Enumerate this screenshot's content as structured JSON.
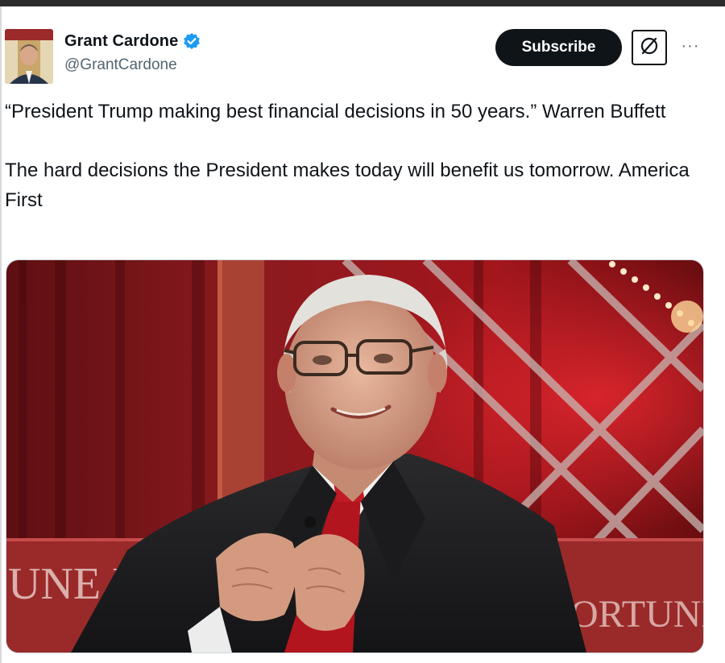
{
  "author": {
    "display_name": "Grant Cardone",
    "handle": "@GrantCardone",
    "verified": true
  },
  "actions": {
    "subscribe_label": "Subscribe",
    "grok_icon": "grok-slash-icon",
    "more_icon": "more-horizontal-icon",
    "more_glyph": "···"
  },
  "tweet": {
    "paragraph_1": "“President Trump making best financial decisions in 50 years.”  Warren Buffett",
    "paragraph_2": "The hard decisions the President makes today will benefit us tomorrow.  America First"
  },
  "media": {
    "backdrop_text_left": "UNE  FO",
    "backdrop_text_right": "ORTUNE"
  },
  "colors": {
    "text_primary": "#0f1419",
    "text_secondary": "#536471",
    "verified_blue": "#1d9bf0",
    "button_dark": "#0f1419",
    "stage_red": "#8b1a1f"
  }
}
